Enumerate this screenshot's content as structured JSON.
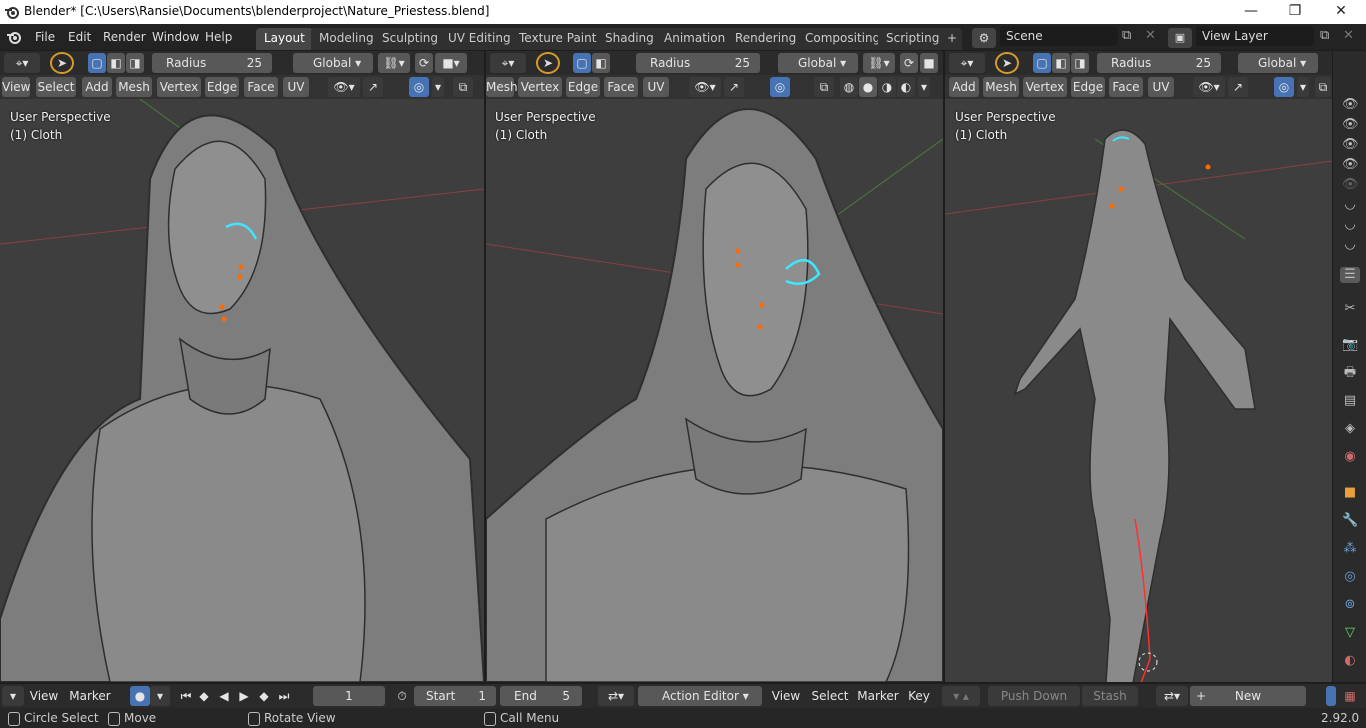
{
  "window": {
    "title": "Blender* [C:\\Users\\Ransie\\Documents\\blenderproject\\Nature_Priestess.blend]",
    "controls": [
      "—",
      "❐",
      "✕"
    ]
  },
  "menubar": [
    "File",
    "Edit",
    "Render",
    "Window",
    "Help"
  ],
  "workspaces": [
    "Layout",
    "Modeling",
    "Sculpting",
    "UV Editing",
    "Texture Paint",
    "Shading",
    "Animation",
    "Rendering",
    "Compositing",
    "Scripting"
  ],
  "active_workspace": "Layout",
  "add_tab": "+",
  "scene": {
    "name": "Scene",
    "layer": "View Layer"
  },
  "tool": {
    "radius_label": "Radius",
    "radius_value": "25",
    "orientation": "Global"
  },
  "edit_menus": {
    "view": "View",
    "select": "Select",
    "add": "Add",
    "mesh": "Mesh",
    "vertex": "Vertex",
    "edge": "Edge",
    "face": "Face",
    "uv": "UV"
  },
  "viewports": [
    {
      "perspective": "User Perspective",
      "object": "(1) Cloth"
    },
    {
      "perspective": "User Perspective",
      "object": "(1) Cloth"
    },
    {
      "perspective": "User Perspective",
      "object": "(1) Cloth"
    }
  ],
  "timeline": {
    "view": "View",
    "marker": "Marker",
    "frame": "1",
    "start_label": "Start",
    "start": "1",
    "end_label": "End",
    "end": "5"
  },
  "action_editor": {
    "mode": "Action Editor",
    "view": "View",
    "select": "Select",
    "marker": "Marker",
    "key": "Key",
    "push_down": "Push Down",
    "stash": "Stash",
    "new": "New"
  },
  "status": {
    "left": "Circle Select",
    "middle": "Move",
    "rotate": "Rotate View",
    "menu": "Call Menu",
    "version": "2.92.0"
  },
  "colors": {
    "accent": "#4772b3",
    "workspace_active": "#474747",
    "viewport_bg": "#3e3e3e",
    "seam": "#00d4ff",
    "vertex": "#ff6a00",
    "x_axis": "#a83a3a"
  }
}
